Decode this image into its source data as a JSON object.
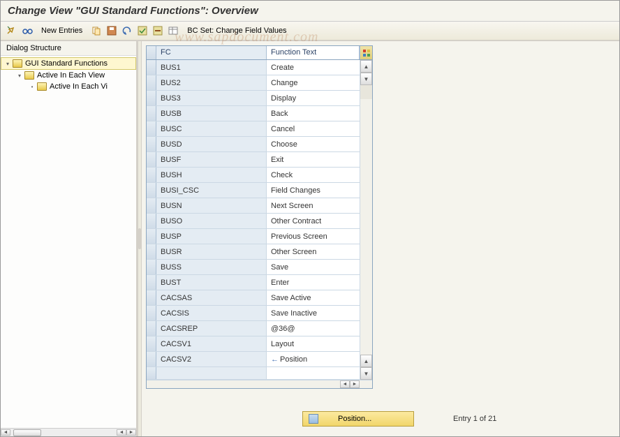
{
  "title": "Change View \"GUI Standard Functions\": Overview",
  "toolbar": {
    "new_entries": "New Entries",
    "bc_set": "BC Set: Change Field Values"
  },
  "sidebar": {
    "header": "Dialog Structure",
    "items": [
      {
        "label": "GUI Standard Functions",
        "level": 0,
        "expanded": true,
        "selected": true,
        "open": true
      },
      {
        "label": "Active In Each View",
        "level": 1,
        "expanded": true,
        "selected": false,
        "open": true
      },
      {
        "label": "Active In Each Vi",
        "level": 2,
        "expanded": false,
        "selected": false,
        "open": false
      }
    ]
  },
  "grid": {
    "headers": {
      "fc": "FC",
      "ft": "Function Text"
    },
    "rows": [
      {
        "fc": "BUS1",
        "ft": "Create"
      },
      {
        "fc": "BUS2",
        "ft": "Change"
      },
      {
        "fc": "BUS3",
        "ft": "Display"
      },
      {
        "fc": "BUSB",
        "ft": "Back"
      },
      {
        "fc": "BUSC",
        "ft": "Cancel"
      },
      {
        "fc": "BUSD",
        "ft": "Choose"
      },
      {
        "fc": "BUSF",
        "ft": "Exit"
      },
      {
        "fc": "BUSH",
        "ft": "Check"
      },
      {
        "fc": "BUSI_CSC",
        "ft": "Field Changes"
      },
      {
        "fc": "BUSN",
        "ft": "Next Screen"
      },
      {
        "fc": "BUSO",
        "ft": "Other Contract"
      },
      {
        "fc": "BUSP",
        "ft": "Previous Screen"
      },
      {
        "fc": "BUSR",
        "ft": "Other Screen"
      },
      {
        "fc": "BUSS",
        "ft": "Save"
      },
      {
        "fc": "BUST",
        "ft": "Enter"
      },
      {
        "fc": "CACSAS",
        "ft": "Save Active"
      },
      {
        "fc": "CACSIS",
        "ft": "Save Inactive"
      },
      {
        "fc": "CACSREP",
        "ft": " @36@"
      },
      {
        "fc": "CACSV1",
        "ft": "Layout"
      },
      {
        "fc": "CACSV2",
        "ft": "Position",
        "icon": "←"
      }
    ]
  },
  "footer": {
    "position_label": "Position...",
    "entry_label": "Entry 1 of 21"
  }
}
